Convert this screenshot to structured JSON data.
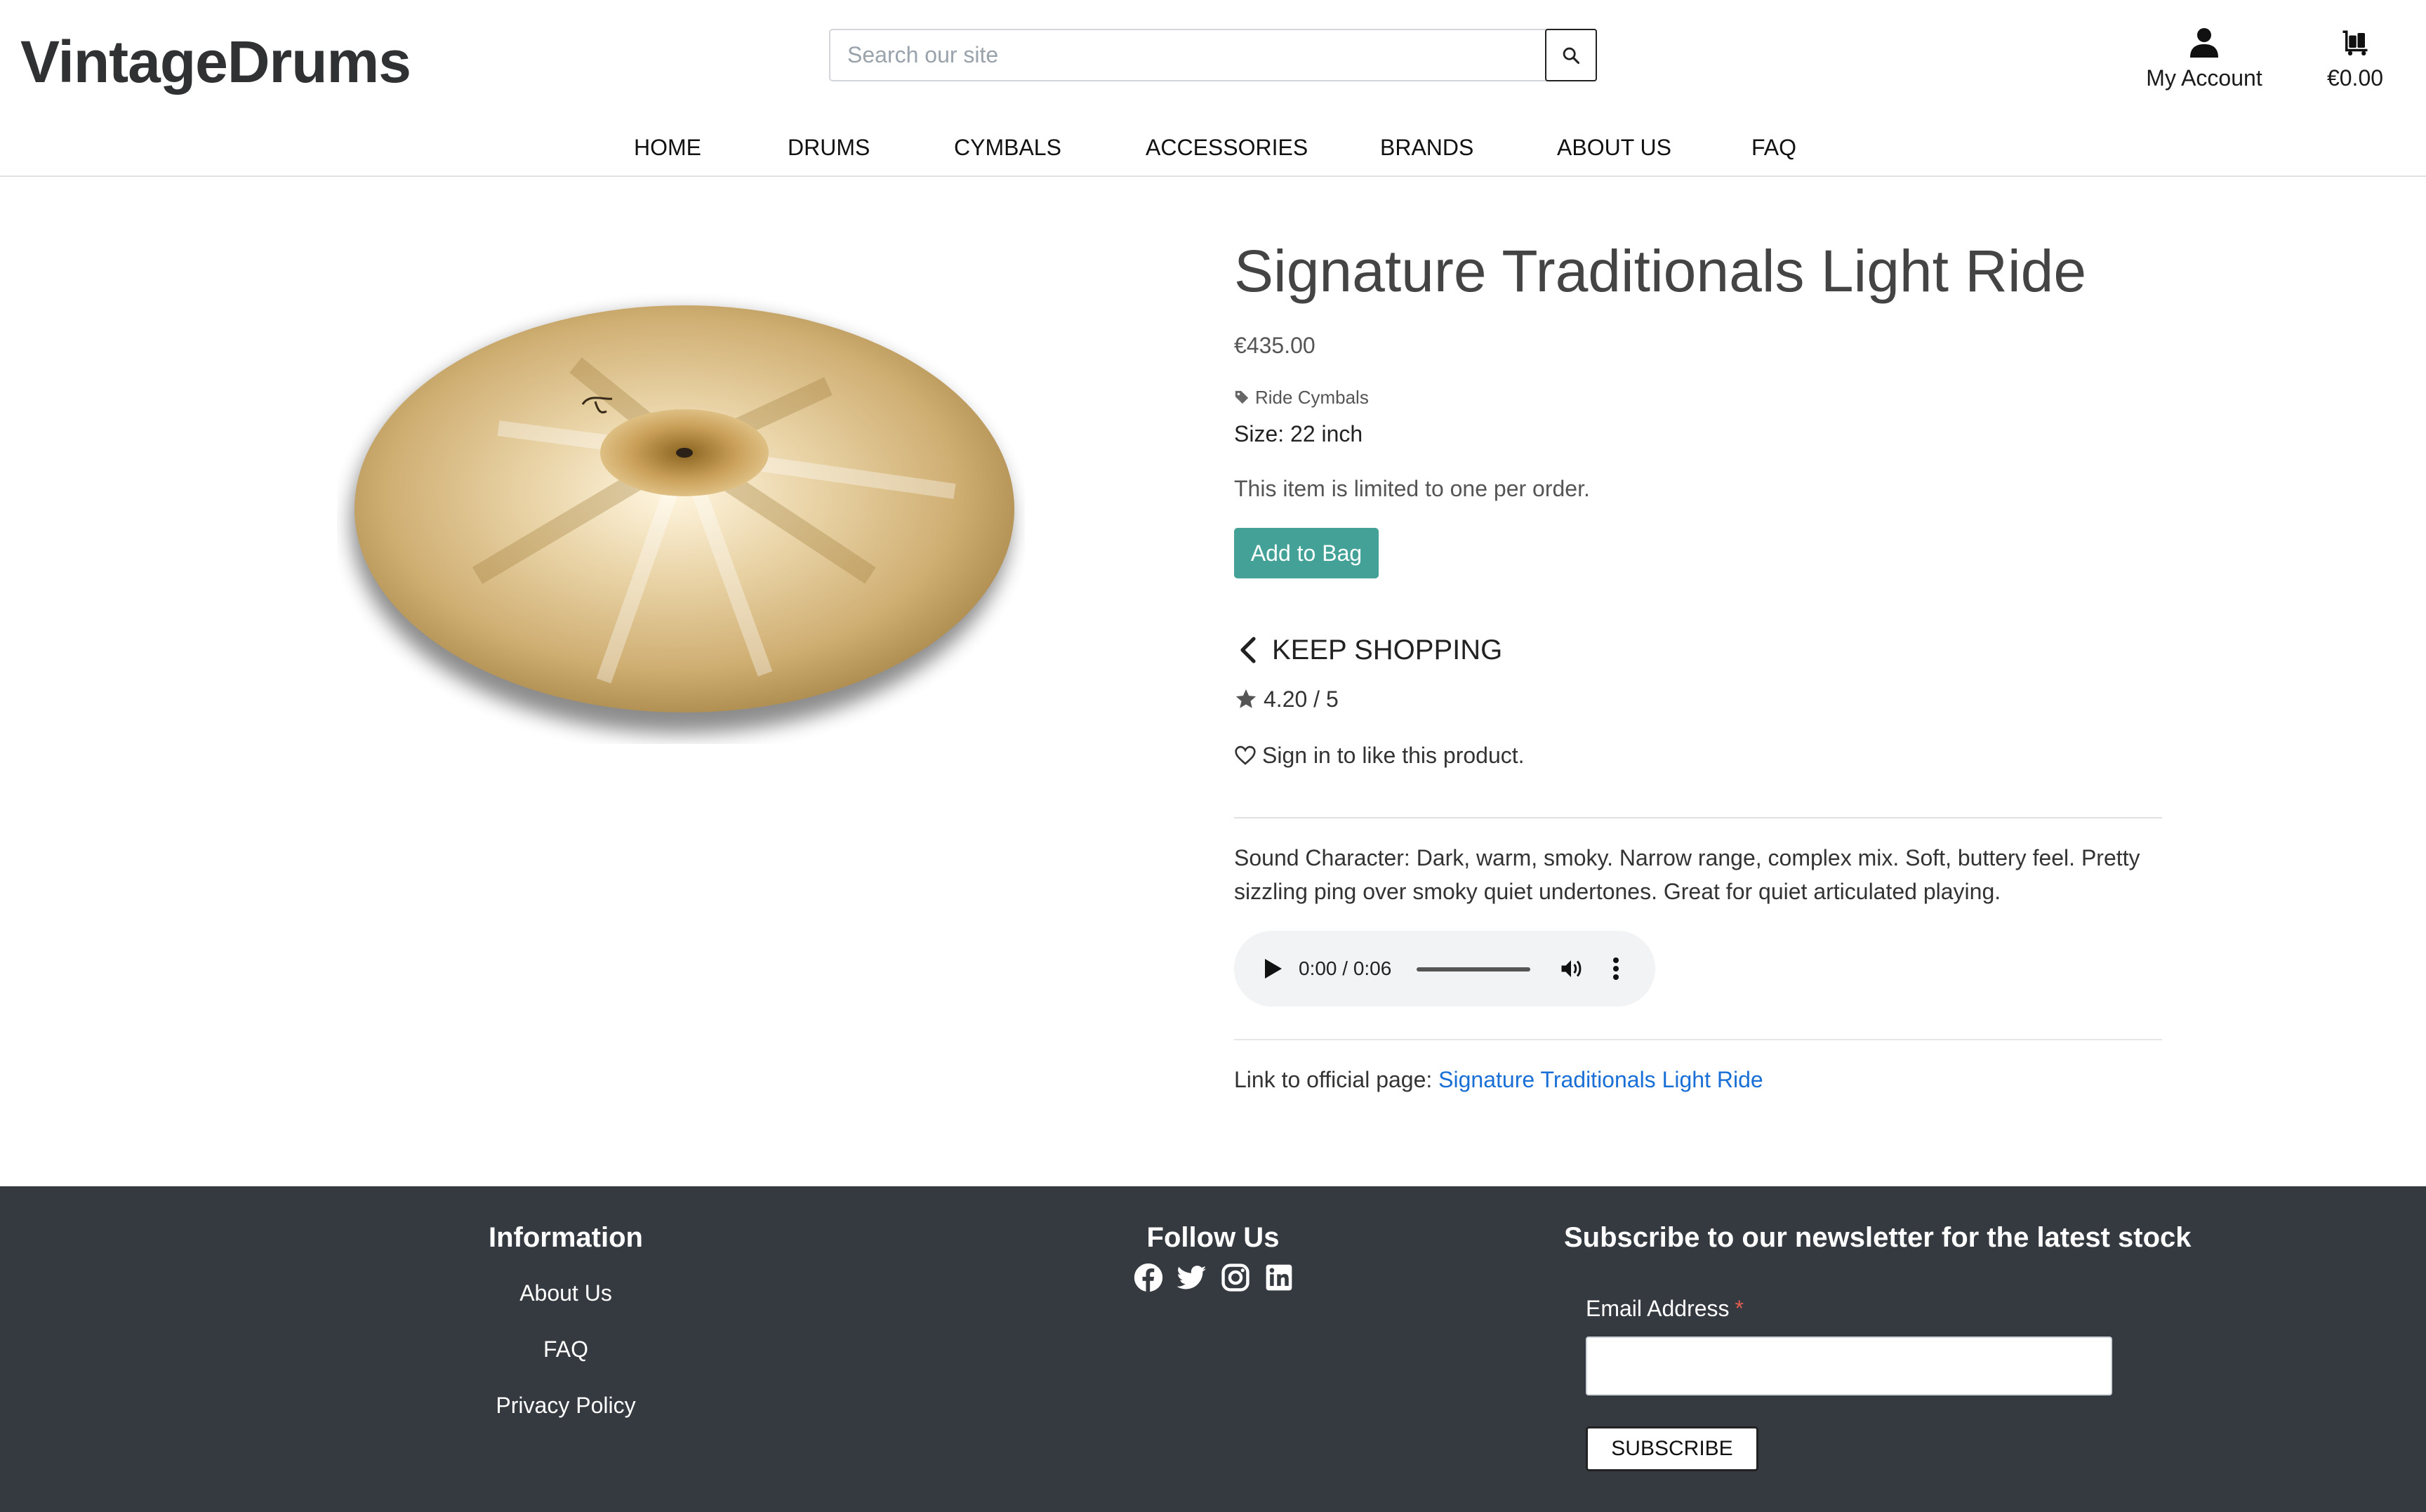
{
  "header": {
    "logo": "VintageDrums",
    "search_placeholder": "Search our site",
    "account_label": "My Account",
    "bag_total": "€0.00"
  },
  "nav": {
    "items": [
      "HOME",
      "DRUMS",
      "CYMBALS",
      "ACCESSORIES",
      "BRANDS",
      "ABOUT US",
      "FAQ"
    ]
  },
  "product": {
    "title": "Signature Traditionals Light Ride",
    "price": "€435.00",
    "category": "Ride Cymbals",
    "size": "Size: 22 inch",
    "limit_notice": "This item is limited to one per order.",
    "add_button": "Add to Bag",
    "keep_shopping": "KEEP SHOPPING",
    "rating": "4.20 / 5",
    "like_text": "Sign in to like this product.",
    "description": "Sound Character: Dark, warm, smoky. Narrow range, complex mix. Soft, buttery feel. Pretty sizzling ping over smoky quiet undertones. Great for quiet articulated playing.",
    "audio_time": "0:00 / 0:06",
    "official_link_prefix": "Link to official page:",
    "official_link_text": "Signature Traditionals Light Ride"
  },
  "footer": {
    "info_heading": "Information",
    "info_links": [
      "About Us",
      "FAQ",
      "Privacy Policy"
    ],
    "follow_heading": "Follow Us",
    "social_icons": [
      "facebook-icon",
      "twitter-icon",
      "instagram-icon",
      "linkedin-icon"
    ],
    "newsletter_heading": "Subscribe to our newsletter for the latest stock",
    "email_label": "Email Address",
    "required_marker": "*",
    "subscribe_button": "SUBSCRIBE"
  },
  "colors": {
    "accent": "#43a197",
    "footer_bg": "#343a40",
    "link": "#1a6fd6"
  }
}
